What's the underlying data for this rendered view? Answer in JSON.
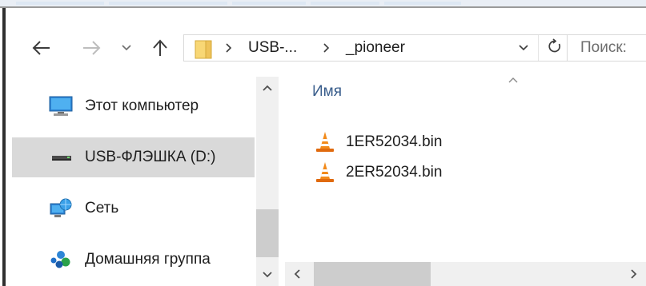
{
  "navigation": {
    "back_icon": "arrow-left-icon",
    "forward_icon": "arrow-right-icon",
    "recent_icon": "chevron-down-icon",
    "up_icon": "arrow-up-icon"
  },
  "address": {
    "folder_icon": "folder-icon",
    "segments": [
      "USB-...",
      "_pioneer"
    ],
    "dropdown_icon": "chevron-down-icon",
    "refresh_icon": "refresh-icon"
  },
  "search": {
    "placeholder": "Поиск:"
  },
  "sidebar": {
    "items": [
      {
        "label": "Этот компьютер",
        "icon": "computer-icon",
        "selected": false
      },
      {
        "label": "USB-ФЛЭШКА (D:)",
        "icon": "usb-drive-icon",
        "selected": true
      },
      {
        "label": "Сеть",
        "icon": "network-icon",
        "selected": false
      },
      {
        "label": "Домашняя группа",
        "icon": "homegroup-icon",
        "selected": false
      }
    ]
  },
  "file_list": {
    "column_header": "Имя",
    "sort_direction": "ascending",
    "files": [
      {
        "name": "1ER52034.bin",
        "icon": "vlc-cone-icon"
      },
      {
        "name": "2ER52034.bin",
        "icon": "vlc-cone-icon"
      }
    ]
  },
  "colors": {
    "header_text": "#3a5e8c",
    "selected_bg": "#d9d9d9",
    "scrollbar_bg": "#f0f0f0",
    "scroll_thumb": "#cdcdcd",
    "folder_yellow": "#f8d775",
    "vlc_orange": "#f28a1a"
  }
}
